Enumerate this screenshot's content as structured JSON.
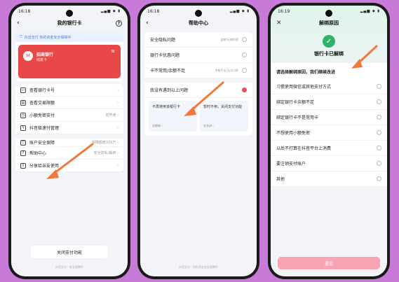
{
  "colors": {
    "background": "#c87ad8",
    "arrow": "#f07a3c",
    "bank_card": "#e84848",
    "accent_pink": "#f04a5e",
    "success_green": "#2fb36a"
  },
  "phone1": {
    "time": "16:18",
    "title": "我的银行卡",
    "banner": "抖音支付 你的资金安全保障中",
    "bank_name": "招商银行",
    "bank_type": "储蓄卡",
    "menu": [
      {
        "label": "查看银行卡号",
        "right": "",
        "icon": "card-icon"
      },
      {
        "label": "查看交易限额",
        "right": "",
        "icon": "limit-icon"
      },
      {
        "label": "小额免密支付",
        "right": "去开通",
        "icon": "clock-icon"
      },
      {
        "label": "抖音极速付管理",
        "right": "",
        "icon": "lightning-icon"
      },
      {
        "label": "账户安全保障",
        "right": "保障额度100万",
        "icon": "shield-icon"
      },
      {
        "label": "帮助中心",
        "right": "安全隐私/解绑",
        "icon": "help-icon"
      },
      {
        "label": "分享给亲友使用",
        "right": "",
        "icon": "share-icon"
      }
    ],
    "bottom_button": "关闭支付功能",
    "footer": "抖音支付 · 安全保障中"
  },
  "phone2": {
    "title": "帮助中心",
    "items": [
      {
        "label": "安全隐私问题",
        "sub": "盗刷/无感扣款"
      },
      {
        "label": "银行卡优惠问题",
        "sub": ""
      },
      {
        "label": "卡不常用/余额不足",
        "sub": "余额不足/无法付款"
      },
      {
        "label": "我没有遇到以上问题",
        "sub": ""
      }
    ],
    "option_a_title": "不再使用该银行卡",
    "option_a_go": "去解绑 ›",
    "option_b_title": "暂时不用，关闭支付功能",
    "option_b_go": "去关闭 ›",
    "footer": "抖音支付 · 你的资金安全保障中"
  },
  "phone3": {
    "time": "16:19",
    "title": "解绑原因",
    "hero": "银行卡已解绑",
    "question": "请选择解绑原因，我们继续改进",
    "reasons": [
      "习惯使用微信或其他支付方式",
      "绑定银行卡余额不足",
      "绑定银行卡不是常用卡",
      "不想使用小额免密",
      "以后不打算在抖音平台上消费",
      "要注销支付账户",
      "其他"
    ],
    "submit": "提交"
  }
}
